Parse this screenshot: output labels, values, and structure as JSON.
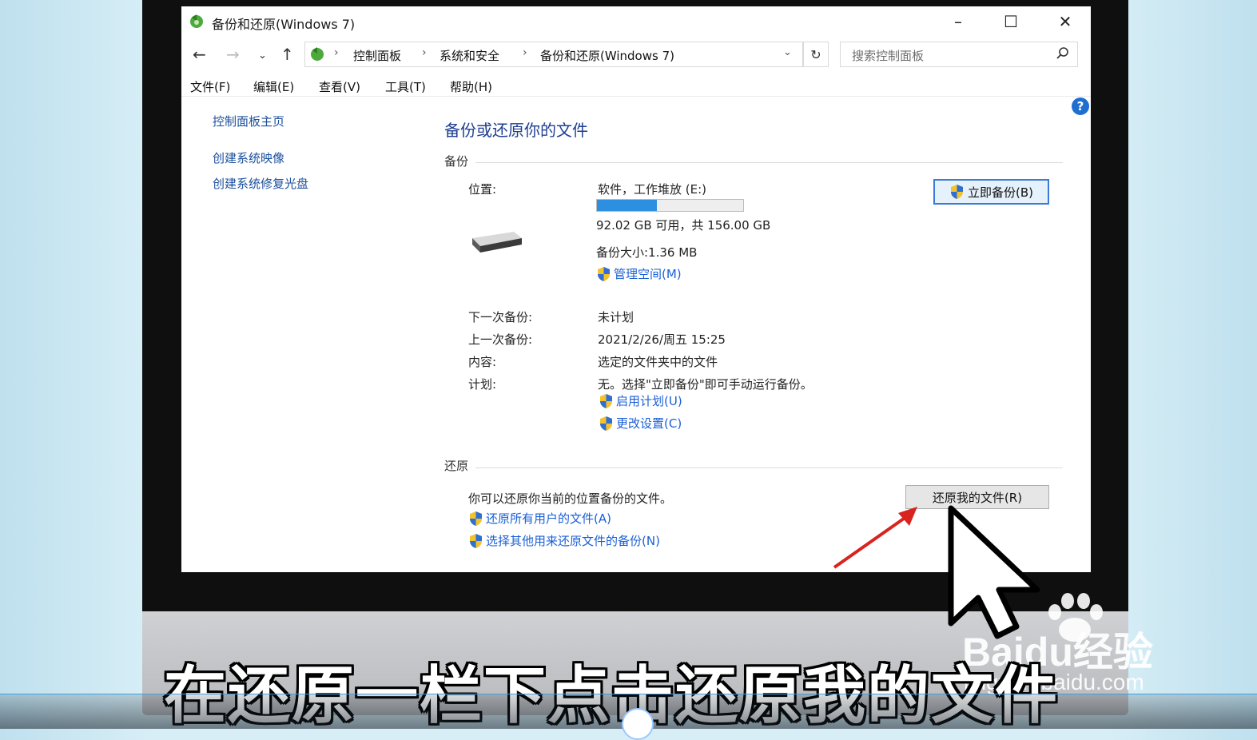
{
  "window": {
    "title": "备份和还原(Windows 7)",
    "controls": {
      "minimize": "–",
      "maximize": "☐",
      "close": "✕"
    }
  },
  "address": {
    "crumbs": [
      "控制面板",
      "系统和安全",
      "备份和还原(Windows 7)"
    ],
    "search_placeholder": "搜索控制面板"
  },
  "menubar": [
    "文件(F)",
    "编辑(E)",
    "查看(V)",
    "工具(T)",
    "帮助(H)"
  ],
  "sidebar": {
    "home": "控制面板主页",
    "links": [
      "创建系统映像",
      "创建系统修复光盘"
    ]
  },
  "main": {
    "heading": "备份或还原你的文件",
    "backup": {
      "section": "备份",
      "location_label": "位置:",
      "location_value": "软件，工作堆放 (E:)",
      "usage_fraction": 0.41,
      "space_text": "92.02 GB 可用，共 156.00 GB",
      "backup_size": "备份大小:1.36 MB",
      "manage_space": "管理空间(M)",
      "backup_now": "立即备份(B)",
      "next_label": "下一次备份:",
      "next_value": "未计划",
      "last_label": "上一次备份:",
      "last_value": "2021/2/26/周五 15:25",
      "content_label": "内容:",
      "content_value": "选定的文件夹中的文件",
      "schedule_label": "计划:",
      "schedule_value": "无。选择\"立即备份\"即可手动运行备份。",
      "enable_schedule": "启用计划(U)",
      "change_settings": "更改设置(C)"
    },
    "restore": {
      "section": "还原",
      "desc": "你可以还原你当前的位置备份的文件。",
      "restore_my_files": "还原我的文件(R)",
      "restore_all_users": "还原所有用户的文件(A)",
      "select_other": "选择其他用来还原文件的备份(N)"
    }
  },
  "overlay": {
    "subtitle": "在还原一栏下点击还原我的文件",
    "watermark_brand": "Baidu经验",
    "watermark_url": "jingyan.baidu.com"
  },
  "colors": {
    "link": "#1a5fd6",
    "heading": "#1e3f91",
    "progress": "#2d8fe0",
    "arrow": "#d8231f"
  }
}
